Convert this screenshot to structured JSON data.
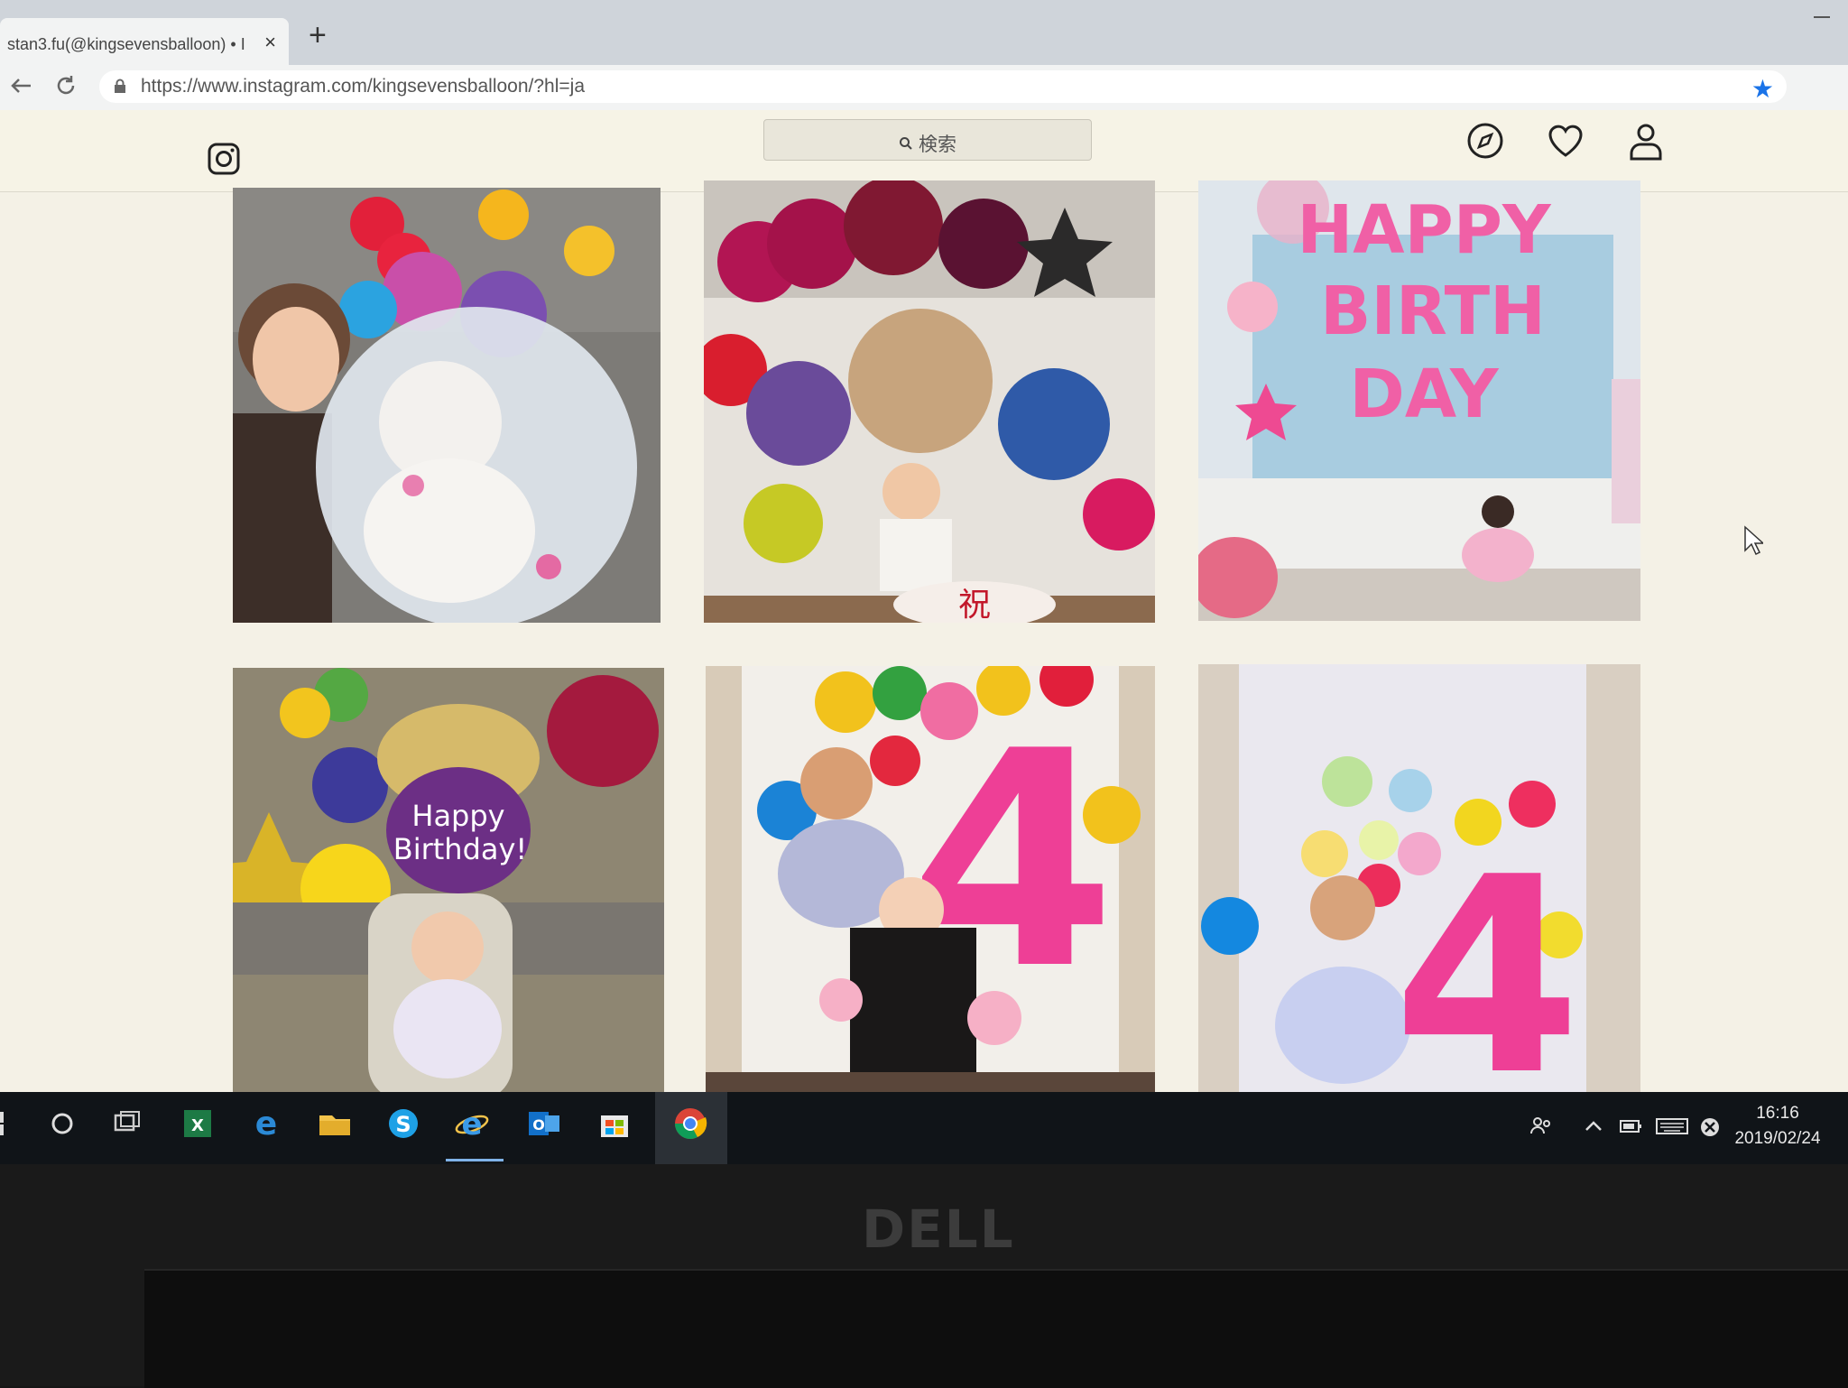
{
  "browser": {
    "tab_title": "stan3.fu(@kingsevensballoon) • I",
    "tab_close": "×",
    "new_tab": "+",
    "url": "https://www.instagram.com/kingsevensballoon/?hl=ja"
  },
  "instagram": {
    "search_placeholder": "検索",
    "posts": [
      {
        "texts": []
      },
      {
        "texts": [
          "祝"
        ]
      },
      {
        "texts": [
          "HAPPY",
          "BIRTH",
          "DAY"
        ]
      },
      {
        "texts": [
          "Happy",
          "Birthday!"
        ]
      },
      {
        "texts": [
          "4"
        ]
      },
      {
        "texts": [
          "4"
        ]
      }
    ]
  },
  "taskbar": {
    "time": "16:16",
    "date": "2019/02/24"
  },
  "hardware": {
    "brand": "DELL"
  },
  "colors": {
    "accent_blue": "#1a73e8",
    "balloon_pink": "#ee3f96",
    "screen_bg": "#f4f1e6"
  },
  "icons": [
    "back-icon",
    "reload-icon",
    "lock-icon",
    "star-icon",
    "instagram-icon",
    "search-icon",
    "explore-icon",
    "heart-icon",
    "profile-icon",
    "windows-icon",
    "search-circle-icon",
    "task-view-icon",
    "excel-icon",
    "edge-icon",
    "folder-icon",
    "skype-icon",
    "ie-icon",
    "outlook-icon",
    "store-icon",
    "chrome-icon",
    "people-icon",
    "chevron-up-icon",
    "battery-icon",
    "keyboard-icon",
    "network-icon",
    "cursor-icon"
  ]
}
